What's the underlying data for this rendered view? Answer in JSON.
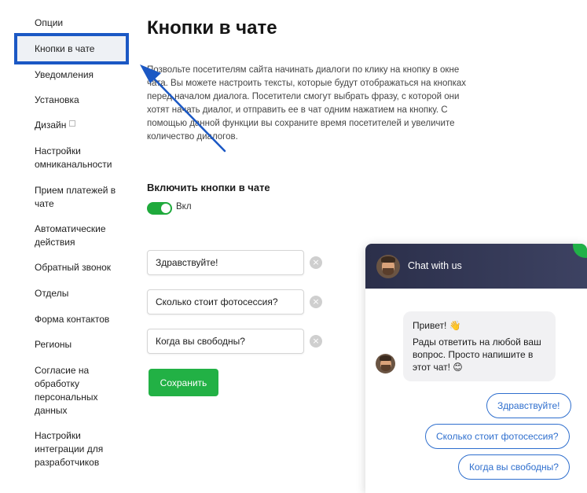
{
  "sidebar": {
    "items": [
      {
        "label": "Опции"
      },
      {
        "label": "Кнопки в чате"
      },
      {
        "label": "Уведомления"
      },
      {
        "label": "Установка"
      },
      {
        "label": "Дизайн"
      },
      {
        "label": "Настройки омниканальности"
      },
      {
        "label": "Прием платежей в чате"
      },
      {
        "label": "Автоматические действия"
      },
      {
        "label": "Обратный звонок"
      },
      {
        "label": "Отделы"
      },
      {
        "label": "Форма контактов"
      },
      {
        "label": "Регионы"
      },
      {
        "label": "Согласие на обработку персональных данных"
      },
      {
        "label": "Настройки интеграции для разработчиков"
      }
    ]
  },
  "main": {
    "title": "Кнопки в чате",
    "description": "Позвольте посетителям сайта начинать диалоги по клику на кнопку в окне чата. Вы можете настроить тексты, которые будут отображаться на кнопках перед началом диалога. Посетители смогут выбрать фразу, с которой они хотят начать диалог, и отправить ее в чат одним нажатием на кнопку. С помощью данной функции вы сохраните время посетителей и увеличите количество диалогов.",
    "toggle": {
      "heading": "Включить кнопки в чате",
      "state_label": "Вкл",
      "enabled": true
    },
    "phrases": [
      {
        "value": "Здравствуйте!"
      },
      {
        "value": "Сколько стоит фотосессия?"
      },
      {
        "value": "Когда вы свободны?"
      }
    ],
    "remove_icon": "×",
    "save_label": "Сохранить"
  },
  "chat": {
    "title": "Chat with us",
    "greeting": "Привет! 👋",
    "message": "Рады ответить на любой ваш вопрос. Просто напишите в этот чат! 😊",
    "quick_buttons": [
      {
        "label": "Здравствуйте!"
      },
      {
        "label": "Сколько стоит фотосессия?"
      },
      {
        "label": "Когда вы свободны?"
      }
    ]
  },
  "colors": {
    "accent_green": "#22b145",
    "highlight_blue": "#1b58c4",
    "chat_header": "#2b2f4a",
    "quick_button": "#2f6fce"
  }
}
